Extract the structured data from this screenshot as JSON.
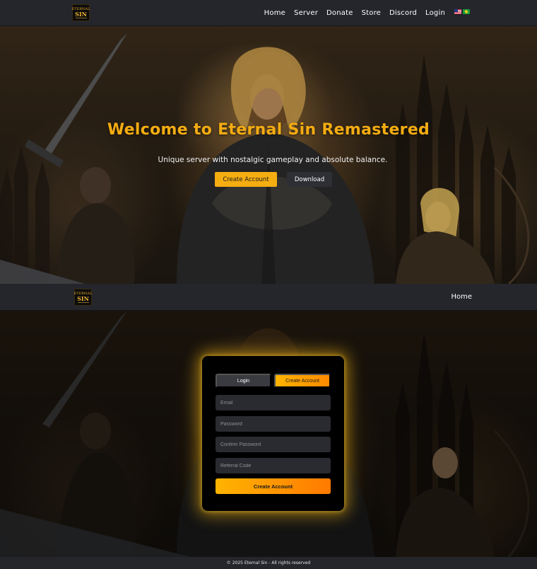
{
  "top_nav": {
    "logo_line1": "ETERNAL",
    "logo_line2": "SIN",
    "links": [
      "Home",
      "Server",
      "Donate",
      "Store",
      "Discord",
      "Login"
    ],
    "flags": [
      "us-flag-icon",
      "brazil-flag-icon"
    ]
  },
  "hero": {
    "title": "Welcome to Eternal Sin Remastered",
    "subtitle": "Unique server with nostalgic gameplay and absolute balance.",
    "create_account_label": "Create Account",
    "download_label": "Download"
  },
  "sub_nav": {
    "logo_line1": "ETERNAL",
    "logo_line2": "SIN",
    "home_label": "Home"
  },
  "auth_card": {
    "tab_login": "Login",
    "tab_create": "Create Account",
    "active_tab": "Create Account",
    "email_placeholder": "Email",
    "password_placeholder": "Password",
    "confirm_password_placeholder": "Confirm Password",
    "referral_placeholder": "Referral Code",
    "submit_label": "Create Account"
  },
  "footer": {
    "text": "© 2025 Eternal Sin - All rights reserved"
  },
  "colors": {
    "accent": "#f5ad12",
    "accent_orange": "#ff8a00",
    "nav_bg": "#24262b",
    "card_bg": "#000000"
  }
}
